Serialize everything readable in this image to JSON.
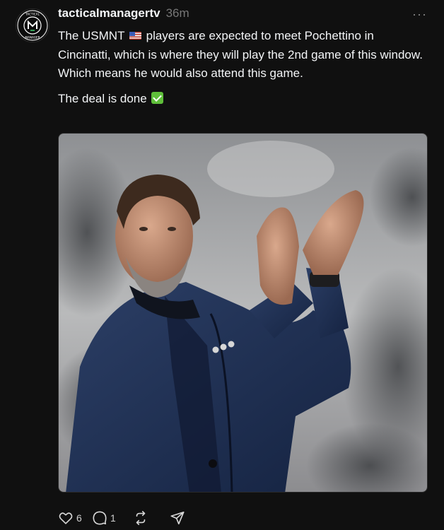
{
  "post": {
    "username": "tacticalmanagertv",
    "time": "36m",
    "more_label": "···",
    "avatar": {
      "logo_text": "TACTICAL MANAGER",
      "icon": "tactical-manager-logo"
    },
    "text": {
      "line1_before_flag": "The USMNT",
      "line1_after_flag": "players are expected to meet Pochettino in Cincinatti, which is where they will play the 2nd game of this window.",
      "line2": "Which means he would also attend this game.",
      "line3": "The deal is done"
    },
    "image": {
      "description_icon": "photo"
    },
    "actions": {
      "like_count": "6",
      "reply_count": "1",
      "icons": [
        "heart-icon",
        "comment-icon",
        "repost-icon",
        "share-icon"
      ]
    }
  },
  "colors": {
    "background": "#101010",
    "text": "#f3f5f7",
    "muted": "#777777",
    "check_green": "#5fbf3a"
  }
}
